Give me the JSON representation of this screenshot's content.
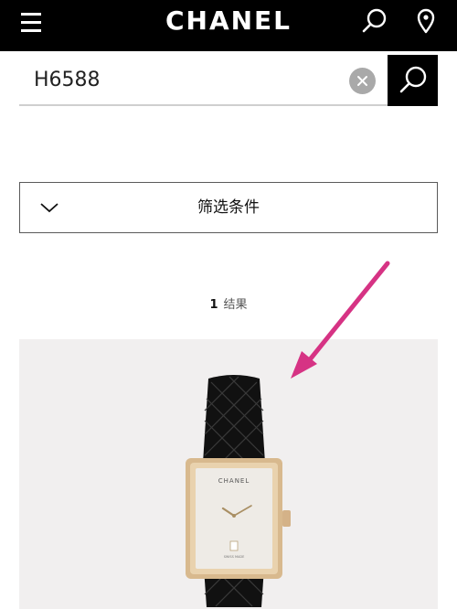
{
  "header": {
    "logo_text": "CHANEL",
    "menu_icon": "hamburger-menu-icon",
    "search_icon": "search-icon",
    "location_icon": "location-pin-icon"
  },
  "search": {
    "value": "H6588",
    "clear_icon": "clear-icon",
    "submit_icon": "search-icon"
  },
  "filter": {
    "label": "筛选条件",
    "icon": "chevron-down-icon"
  },
  "results": {
    "count": "1",
    "label": "结果"
  },
  "product": {
    "watch_brand": "CHANEL",
    "watch_subtext": "SWISS MADE",
    "image_description_icon": "watch-image"
  },
  "annotation": {
    "color": "#d63384"
  }
}
